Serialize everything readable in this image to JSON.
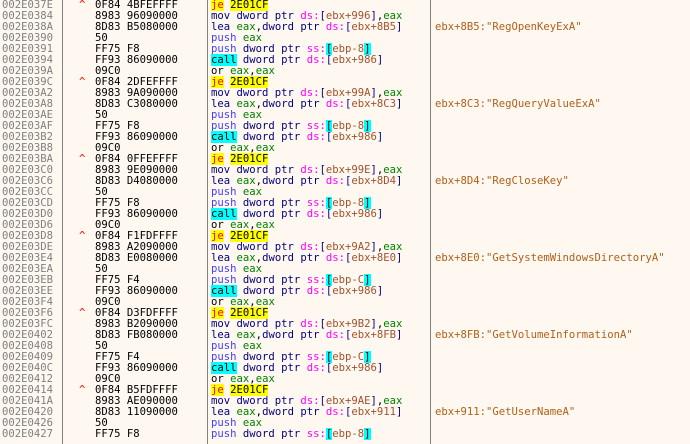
{
  "colors": {
    "background": "#fff8f0",
    "address": "#808080",
    "jump": "#ff0000",
    "jump_highlight": "#ffff00",
    "call_highlight": "#00ffff",
    "comment": "#b0601a"
  },
  "rows": [
    {
      "addr": "002E037E",
      "arrow": "^",
      "bytes": "0F84 4BFEFFFF",
      "mn": "je",
      "ops": "2E01CF",
      "comment": ""
    },
    {
      "addr": "002E0384",
      "arrow": "",
      "bytes": "8983 96090000",
      "mn": "mov",
      "ops": "dword ptr ds:[ebx+996],eax",
      "comment": ""
    },
    {
      "addr": "002E038A",
      "arrow": "",
      "bytes": "8D83 B5080000",
      "mn": "lea",
      "ops": "eax,dword ptr ds:[ebx+8B5]",
      "comment": "ebx+8B5:\"RegOpenKeyExA\""
    },
    {
      "addr": "002E0390",
      "arrow": "",
      "bytes": "50",
      "mn": "push",
      "ops": "eax",
      "comment": ""
    },
    {
      "addr": "002E0391",
      "arrow": "",
      "bytes": "FF75 F8",
      "mn": "push",
      "ops": "dword ptr ss:[ebp-8]",
      "comment": ""
    },
    {
      "addr": "002E0394",
      "arrow": "",
      "bytes": "FF93 86090000",
      "mn": "call",
      "ops": "dword ptr ds:[ebx+986]",
      "comment": ""
    },
    {
      "addr": "002E039A",
      "arrow": "",
      "bytes": "09C0",
      "mn": "or",
      "ops": "eax,eax",
      "comment": ""
    },
    {
      "addr": "002E039C",
      "arrow": "^",
      "bytes": "0F84 2DFEFFFF",
      "mn": "je",
      "ops": "2E01CF",
      "comment": ""
    },
    {
      "addr": "002E03A2",
      "arrow": "",
      "bytes": "8983 9A090000",
      "mn": "mov",
      "ops": "dword ptr ds:[ebx+99A],eax",
      "comment": ""
    },
    {
      "addr": "002E03A8",
      "arrow": "",
      "bytes": "8D83 C3080000",
      "mn": "lea",
      "ops": "eax,dword ptr ds:[ebx+8C3]",
      "comment": "ebx+8C3:\"RegQueryValueExA\""
    },
    {
      "addr": "002E03AE",
      "arrow": "",
      "bytes": "50",
      "mn": "push",
      "ops": "eax",
      "comment": ""
    },
    {
      "addr": "002E03AF",
      "arrow": "",
      "bytes": "FF75 F8",
      "mn": "push",
      "ops": "dword ptr ss:[ebp-8]",
      "comment": ""
    },
    {
      "addr": "002E03B2",
      "arrow": "",
      "bytes": "FF93 86090000",
      "mn": "call",
      "ops": "dword ptr ds:[ebx+986]",
      "comment": ""
    },
    {
      "addr": "002E03B8",
      "arrow": "",
      "bytes": "09C0",
      "mn": "or",
      "ops": "eax,eax",
      "comment": ""
    },
    {
      "addr": "002E03BA",
      "arrow": "^",
      "bytes": "0F84 0FFEFFFF",
      "mn": "je",
      "ops": "2E01CF",
      "comment": ""
    },
    {
      "addr": "002E03C0",
      "arrow": "",
      "bytes": "8983 9E090000",
      "mn": "mov",
      "ops": "dword ptr ds:[ebx+99E],eax",
      "comment": ""
    },
    {
      "addr": "002E03C6",
      "arrow": "",
      "bytes": "8D83 D4080000",
      "mn": "lea",
      "ops": "eax,dword ptr ds:[ebx+8D4]",
      "comment": "ebx+8D4:\"RegCloseKey\""
    },
    {
      "addr": "002E03CC",
      "arrow": "",
      "bytes": "50",
      "mn": "push",
      "ops": "eax",
      "comment": ""
    },
    {
      "addr": "002E03CD",
      "arrow": "",
      "bytes": "FF75 F8",
      "mn": "push",
      "ops": "dword ptr ss:[ebp-8]",
      "comment": ""
    },
    {
      "addr": "002E03D0",
      "arrow": "",
      "bytes": "FF93 86090000",
      "mn": "call",
      "ops": "dword ptr ds:[ebx+986]",
      "comment": ""
    },
    {
      "addr": "002E03D6",
      "arrow": "",
      "bytes": "09C0",
      "mn": "or",
      "ops": "eax,eax",
      "comment": ""
    },
    {
      "addr": "002E03D8",
      "arrow": "^",
      "bytes": "0F84 F1FDFFFF",
      "mn": "je",
      "ops": "2E01CF",
      "comment": ""
    },
    {
      "addr": "002E03DE",
      "arrow": "",
      "bytes": "8983 A2090000",
      "mn": "mov",
      "ops": "dword ptr ds:[ebx+9A2],eax",
      "comment": ""
    },
    {
      "addr": "002E03E4",
      "arrow": "",
      "bytes": "8D83 E0080000",
      "mn": "lea",
      "ops": "eax,dword ptr ds:[ebx+8E0]",
      "comment": "ebx+8E0:\"GetSystemWindowsDirectoryA\""
    },
    {
      "addr": "002E03EA",
      "arrow": "",
      "bytes": "50",
      "mn": "push",
      "ops": "eax",
      "comment": ""
    },
    {
      "addr": "002E03EB",
      "arrow": "",
      "bytes": "FF75 F4",
      "mn": "push",
      "ops": "dword ptr ss:[ebp-C]",
      "comment": ""
    },
    {
      "addr": "002E03EE",
      "arrow": "",
      "bytes": "FF93 86090000",
      "mn": "call",
      "ops": "dword ptr ds:[ebx+986]",
      "comment": ""
    },
    {
      "addr": "002E03F4",
      "arrow": "",
      "bytes": "09C0",
      "mn": "or",
      "ops": "eax,eax",
      "comment": ""
    },
    {
      "addr": "002E03F6",
      "arrow": "^",
      "bytes": "0F84 D3FDFFFF",
      "mn": "je",
      "ops": "2E01CF",
      "comment": ""
    },
    {
      "addr": "002E03FC",
      "arrow": "",
      "bytes": "8983 B2090000",
      "mn": "mov",
      "ops": "dword ptr ds:[ebx+9B2],eax",
      "comment": ""
    },
    {
      "addr": "002E0402",
      "arrow": "",
      "bytes": "8D83 FB080000",
      "mn": "lea",
      "ops": "eax,dword ptr ds:[ebx+8FB]",
      "comment": "ebx+8FB:\"GetVolumeInformationA\""
    },
    {
      "addr": "002E0408",
      "arrow": "",
      "bytes": "50",
      "mn": "push",
      "ops": "eax",
      "comment": ""
    },
    {
      "addr": "002E0409",
      "arrow": "",
      "bytes": "FF75 F4",
      "mn": "push",
      "ops": "dword ptr ss:[ebp-C]",
      "comment": ""
    },
    {
      "addr": "002E040C",
      "arrow": "",
      "bytes": "FF93 86090000",
      "mn": "call",
      "ops": "dword ptr ds:[ebx+986]",
      "comment": ""
    },
    {
      "addr": "002E0412",
      "arrow": "",
      "bytes": "09C0",
      "mn": "or",
      "ops": "eax,eax",
      "comment": ""
    },
    {
      "addr": "002E0414",
      "arrow": "^",
      "bytes": "0F84 B5FDFFFF",
      "mn": "je",
      "ops": "2E01CF",
      "comment": ""
    },
    {
      "addr": "002E041A",
      "arrow": "",
      "bytes": "8983 AE090000",
      "mn": "mov",
      "ops": "dword ptr ds:[ebx+9AE],eax",
      "comment": ""
    },
    {
      "addr": "002E0420",
      "arrow": "",
      "bytes": "8D83 11090000",
      "mn": "lea",
      "ops": "eax,dword ptr ds:[ebx+911]",
      "comment": "ebx+911:\"GetUserNameA\""
    },
    {
      "addr": "002E0426",
      "arrow": "",
      "bytes": "50",
      "mn": "push",
      "ops": "eax",
      "comment": ""
    },
    {
      "addr": "002E0427",
      "arrow": "",
      "bytes": "FF75 F8",
      "mn": "push",
      "ops": "dword ptr ss:[ebp-8]",
      "comment": ""
    }
  ]
}
